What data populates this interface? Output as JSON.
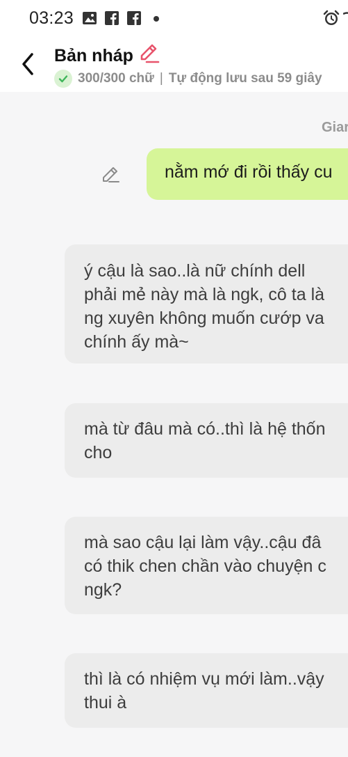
{
  "status_bar": {
    "time": "03:23",
    "icons": [
      "gallery-icon",
      "facebook-icon",
      "facebook-icon",
      "notification-dot",
      "alarm-icon"
    ]
  },
  "header": {
    "title": "Bản nháp",
    "word_count": "300/300 chữ",
    "separator": "|",
    "autosave": "Tự động lưu sau 59 giây"
  },
  "chat": {
    "sender_name": "Giar",
    "sent_message": "nằm mớ đi rồi thấy cu",
    "received_messages": [
      "ý cậu là sao..là nữ chính dell\nphải mẻ này mà là ngk, cô ta là\nng xuyên không muốn cướp va\nchính ấy mà~",
      "mà từ đâu mà có..thì là hệ thốn\ncho",
      "mà sao cậu lại làm vậy..cậu đâ\ncó thik chen chần vào chuyện c\nngk?",
      "thì là có nhiệm vụ mới làm..vậy\nthui à"
    ]
  },
  "colors": {
    "sent_bubble": "#d6f598",
    "received_bubble": "#ececec",
    "edit_accent": "#e8536b",
    "check_green": "#3fb55a"
  }
}
